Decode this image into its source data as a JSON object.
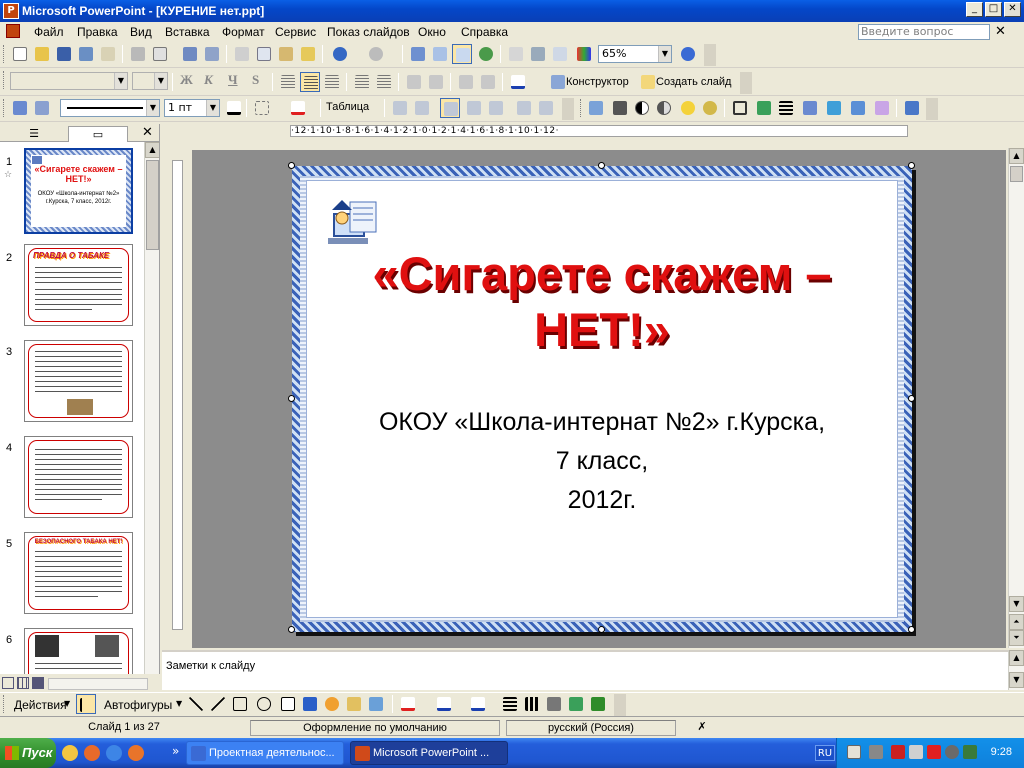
{
  "window": {
    "title": "Microsoft PowerPoint - [КУРЕНИЕ нет.ppt]",
    "app_icon": "powerpoint-icon",
    "min_label": "_",
    "max_label": "□",
    "close_label": "✕"
  },
  "menu": {
    "items": [
      "Файл",
      "Правка",
      "Вид",
      "Вставка",
      "Формат",
      "Сервис",
      "Показ слайдов",
      "Окно",
      "Справка"
    ],
    "ask_placeholder": "Введите вопрос",
    "close_label": "✕"
  },
  "toolbar_standard": {
    "zoom": "65%",
    "help_icon": "help-icon"
  },
  "toolbar_format": {
    "font_value": "",
    "size_value": "",
    "bold": "Ж",
    "italic": "К",
    "underline": "Ч",
    "shadow": "S",
    "designer_label": "Конструктор",
    "new_slide_label": "Создать слайд"
  },
  "toolbar_tables": {
    "line_weight": "1 пт",
    "table_label": "Таблица"
  },
  "left_pane": {
    "tab_outline_icon": "outline-icon",
    "tab_slides_icon": "slides-icon",
    "close_label": "✕",
    "thumbnails": [
      {
        "num": "1",
        "title": "«Сигарете скажем – НЕТ!»",
        "sub": "ОКОУ «Школа-интернат №2» г.Курска, 7 класс, 2012г."
      },
      {
        "num": "2",
        "title": "ПРАВДА О ТАБАКЕ"
      },
      {
        "num": "3"
      },
      {
        "num": "4"
      },
      {
        "num": "5",
        "title": "БЕЗОПАСНОГО ТАБАКА НЕТ!"
      },
      {
        "num": "6"
      }
    ]
  },
  "ruler": {
    "h_text": "·12·1·10·1·8·1·6·1·4·1·2·1·0·1·2·1·4·1·6·1·8·1·10·1·12·"
  },
  "slide": {
    "title_line1": "«Сигарете скажем –",
    "title_line2": "НЕТ!»",
    "sub_line1": "ОКОУ «Школа-интернат №2» г.Курска,",
    "sub_line2": "7 класс,",
    "sub_line3": "2012г.",
    "logo_icon": "computer-logo-icon"
  },
  "notes": {
    "placeholder": "Заметки к слайду"
  },
  "drawing_toolbar": {
    "actions_label": "Действия",
    "autoshapes_label": "Автофигуры"
  },
  "status": {
    "slide_info": "Слайд 1 из 27",
    "design": "Оформление по умолчанию",
    "language": "русский (Россия)"
  },
  "taskbar": {
    "start_label": "Пуск",
    "tasks": [
      {
        "label": "Проектная деятельнос...",
        "icon": "word-icon"
      },
      {
        "label": "Microsoft PowerPoint ...",
        "icon": "powerpoint-icon"
      }
    ],
    "lang": "RU",
    "clock": "9:28"
  },
  "colors": {
    "title_red": "#e01010",
    "xp_blue": "#0a5fe6",
    "start_green": "#2f8c2a"
  }
}
